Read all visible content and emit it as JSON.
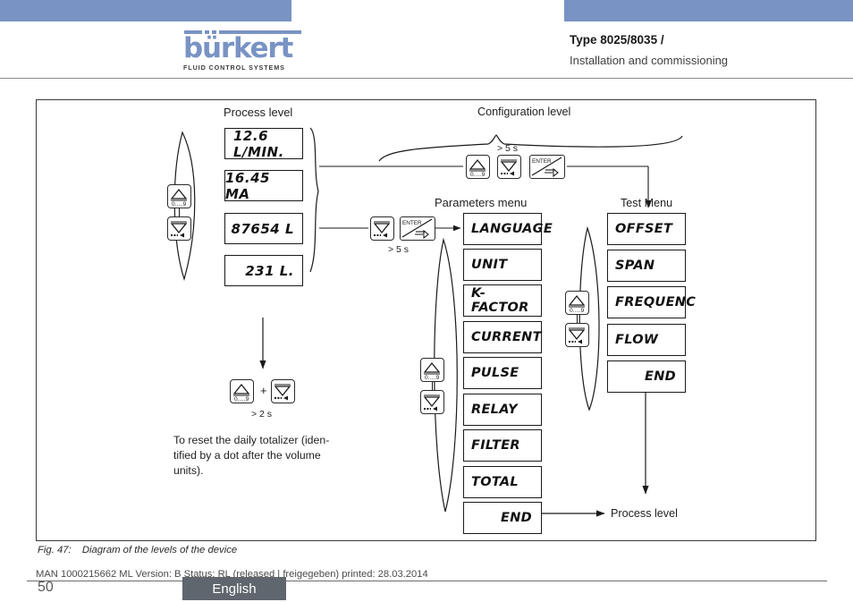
{
  "header": {
    "logo_word": "bürkert",
    "logo_tagline": "FLUID CONTROL SYSTEMS",
    "title": "Type 8025/8035 /",
    "subtitle": "Installation and commissioning"
  },
  "figure": {
    "process_level_label": "Process level",
    "configuration_level_label": "Configuration level",
    "parameters_menu_label": "Parameters menu",
    "test_menu_label": "Test Menu",
    "return_label": "Process level",
    "timing_config": "> 5 s",
    "timing_params": "> 5 s",
    "timing_reset": "> 2 s",
    "plus_sign": "+",
    "process_displays": [
      {
        "value": "12.6 L/MIN.",
        "align": "left"
      },
      {
        "value": "16.45 MA",
        "align": "right"
      },
      {
        "value": "87654 L",
        "align": "right"
      },
      {
        "value": "231 L.",
        "align": "right"
      }
    ],
    "parameters_menu": [
      {
        "label": "LANGUAGE",
        "align": "left"
      },
      {
        "label": "UNIT",
        "align": "left"
      },
      {
        "label": "K-FACTOR",
        "align": "left"
      },
      {
        "label": "CURRENT",
        "align": "left"
      },
      {
        "label": "PULSE",
        "align": "left"
      },
      {
        "label": "RELAY",
        "align": "left"
      },
      {
        "label": "FILTER",
        "align": "left"
      },
      {
        "label": "TOTAL",
        "align": "left"
      },
      {
        "label": "END",
        "align": "right"
      }
    ],
    "test_menu": [
      {
        "label": "OFFSET",
        "align": "left"
      },
      {
        "label": "SPAN",
        "align": "left"
      },
      {
        "label": "FREQUENC",
        "align": "left"
      },
      {
        "label": "FLOW",
        "align": "left"
      },
      {
        "label": "END",
        "align": "right"
      }
    ],
    "keys": {
      "up_label": "0.....9",
      "enter_label": "ENTER"
    },
    "note": "To reset the daily totalizer (iden-tified by a dot after the volume units)."
  },
  "caption": {
    "number": "Fig. 47:",
    "text": "Diagram of the levels of the device"
  },
  "footer": {
    "watermark": "MAN 1000215662 ML Version: B Status: RL (released | freigegeben) printed: 28.03.2014",
    "page_number": "50",
    "language_tab": "English"
  },
  "colors": {
    "brand_blue": "#7893c4",
    "tab_gray": "#5f666e",
    "ink": "#1a1a1a"
  }
}
